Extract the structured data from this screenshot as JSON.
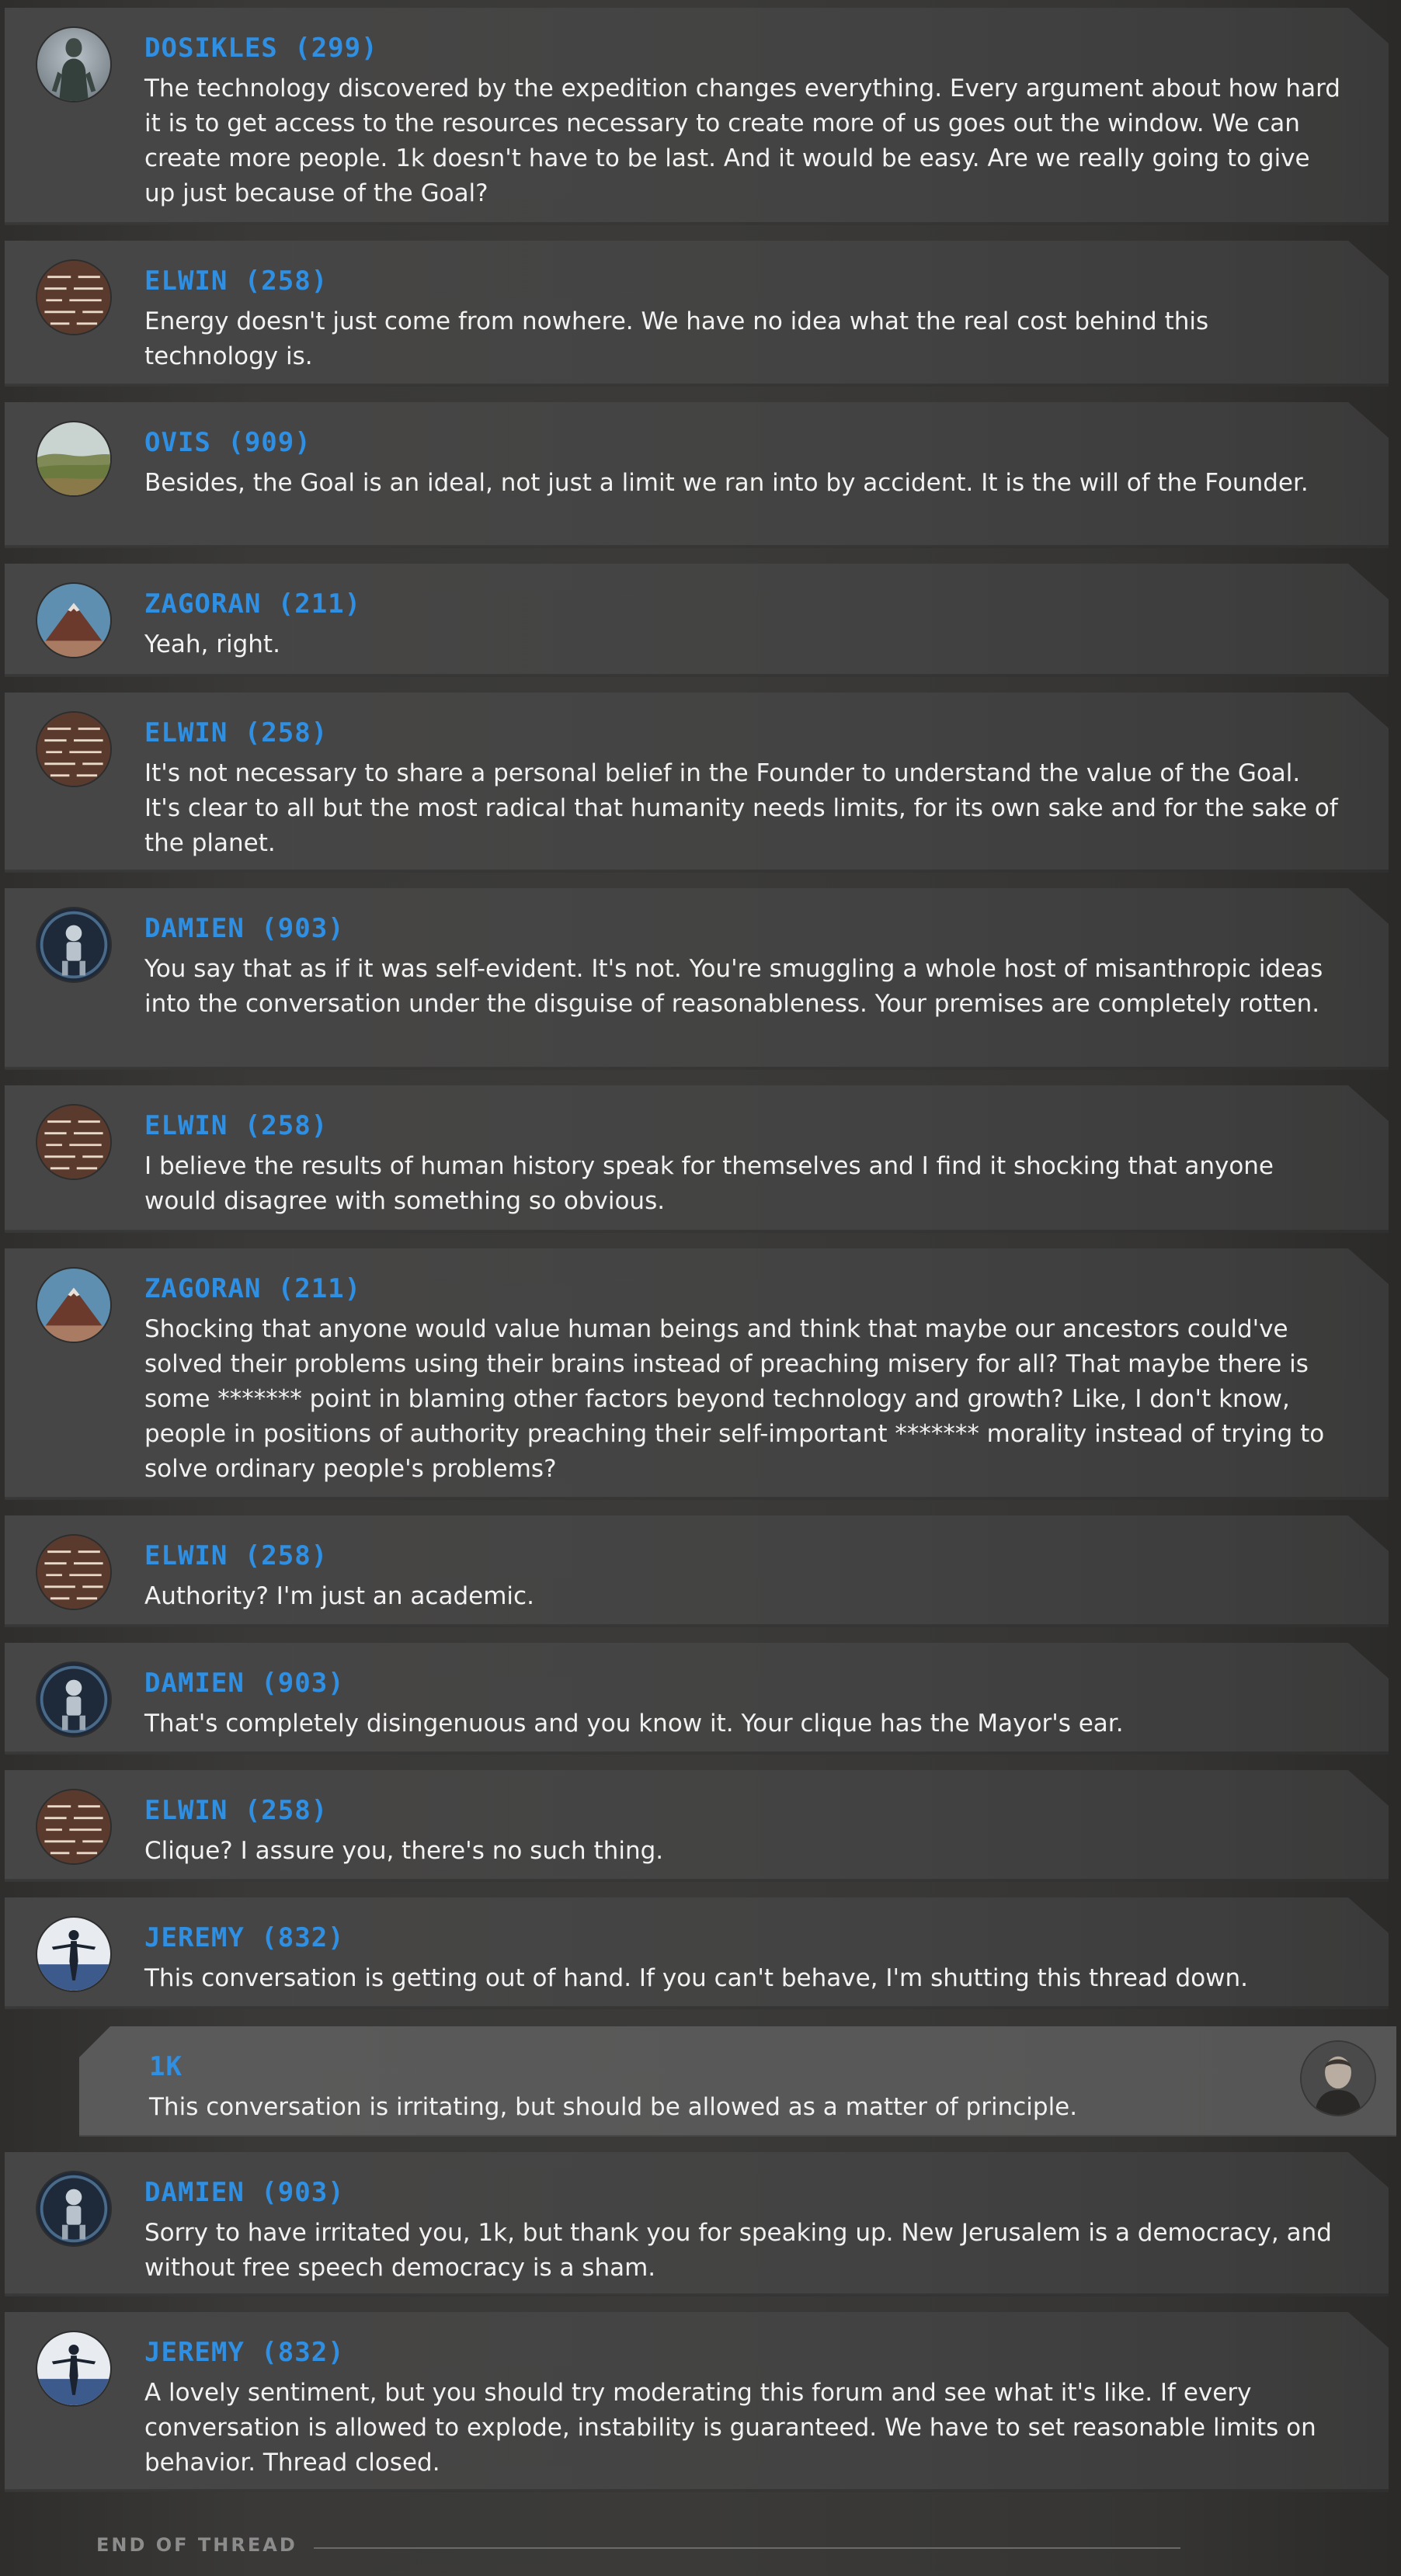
{
  "thread": {
    "messages": [
      {
        "author": "DOSIKLES (299)",
        "avatar": "statue-avatar",
        "text": "The technology discovered by the expedition changes everything. Every argument about how hard it is to get access to the resources necessary to create more of us goes out the window. We can create more people. 1k doesn't have to be last. And it would be easy. Are we really going to give up just because of the Goal?"
      },
      {
        "author": "ELWIN (258)",
        "avatar": "circuit-avatar",
        "text": "Energy doesn't just come from nowhere. We have no idea what the real cost behind this technology is."
      },
      {
        "author": "OVIS (909)",
        "avatar": "landscape-avatar",
        "text": "Besides, the Goal is an ideal, not just a limit we ran into by accident. It is the will of the Founder."
      },
      {
        "author": "ZAGORAN (211)",
        "avatar": "mountain-avatar",
        "text": "Yeah, right."
      },
      {
        "author": "ELWIN (258)",
        "avatar": "circuit-avatar",
        "text": "It's not necessary to share a personal belief in the Founder to understand the value of the Goal. It's clear to all but the most radical that humanity needs limits, for its own sake and for the sake of the planet."
      },
      {
        "author": "DAMIEN (903)",
        "avatar": "robot-avatar",
        "text": "You say that as if it was self-evident. It's not. You're smuggling a whole host of misanthropic ideas into the conversation under the disguise of reasonableness. Your premises are completely rotten."
      },
      {
        "author": "ELWIN (258)",
        "avatar": "circuit-avatar",
        "text": "I believe the results of human history speak for themselves and I find it shocking that anyone would disagree with something so obvious."
      },
      {
        "author": "ZAGORAN (211)",
        "avatar": "mountain-avatar",
        "text": "Shocking that anyone would value human beings and think that maybe our ancestors could've solved their problems using their brains instead of preaching misery for all? That maybe there is some ******* point in blaming other factors beyond technology and growth? Like, I don't know, people in positions of authority preaching their self-important ******* morality instead of trying to solve ordinary people's problems?"
      },
      {
        "author": "ELWIN (258)",
        "avatar": "circuit-avatar",
        "text": "Authority? I'm just an academic."
      },
      {
        "author": "DAMIEN (903)",
        "avatar": "robot-avatar",
        "text": "That's completely disingenuous and you know it. Your clique has the Mayor's ear."
      },
      {
        "author": "ELWIN (258)",
        "avatar": "circuit-avatar",
        "text": "Clique? I assure you, there's no such thing."
      },
      {
        "author": "JEREMY (832)",
        "avatar": "figure-avatar",
        "text": "This conversation is getting out of hand. If you can't behave, I'm shutting this thread down."
      },
      {
        "author": "1K",
        "avatar": "portrait-avatar",
        "text": "This conversation is irritating, but should be allowed as a matter of principle."
      },
      {
        "author": "DAMIEN (903)",
        "avatar": "robot-avatar",
        "text": "Sorry to have irritated you, 1k, but thank you for speaking up. New Jerusalem is a democracy, and without free speech democracy is a sham."
      },
      {
        "author": "JEREMY (832)",
        "avatar": "figure-avatar",
        "text": "A lovely sentiment, but you should try moderating this forum and see what it's like. If every conversation is allowed to explode, instability is guaranteed. We have to set reasonable limits on behavior. Thread closed."
      }
    ]
  },
  "footer": {
    "end_label": "END OF THREAD"
  },
  "colors": {
    "author_name": "#2f8fe3",
    "message_text": "#f2f2f2",
    "card_background": "#464646",
    "own_card_background": "#5a5a5a",
    "page_background": "#383735"
  }
}
